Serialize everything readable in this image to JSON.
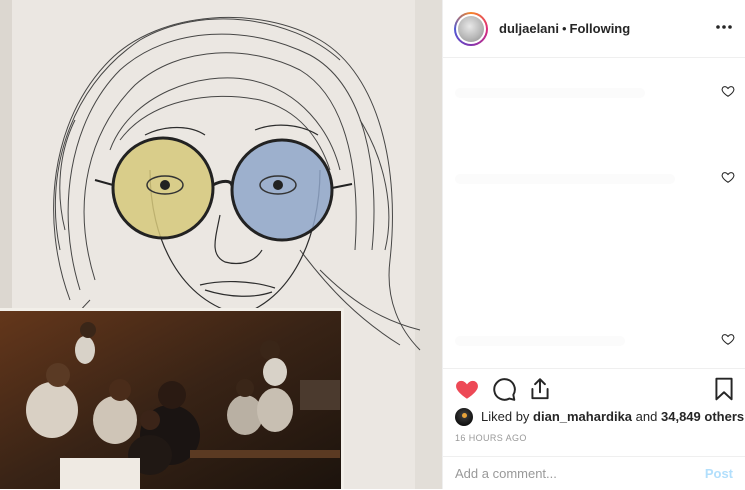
{
  "post": {
    "image": {
      "alt": "",
      "main_content": "pen sketch portrait with tinted round glasses",
      "inset_content": "group photo"
    }
  },
  "header": {
    "username": "duljaelani",
    "separator": "•",
    "follow_status": "Following",
    "more_icon": "more-options-icon"
  },
  "comments": {
    "items": [
      {
        "heart_icon": "heart-outline-icon"
      },
      {
        "heart_icon": "heart-outline-icon"
      },
      {
        "heart_icon": "heart-outline-icon"
      }
    ]
  },
  "actions": {
    "like_icon": "heart-filled-icon",
    "comment_icon": "comment-icon",
    "share_icon": "share-icon",
    "save_icon": "bookmark-icon",
    "like_color": "#ed4956"
  },
  "likes": {
    "prefix": "Liked by",
    "first_user": "dian_mahardika",
    "conjunction": "and",
    "others": "34,849 others"
  },
  "timestamp": "16 HOURS AGO",
  "add_comment": {
    "placeholder": "Add a comment...",
    "post_label": "Post"
  }
}
